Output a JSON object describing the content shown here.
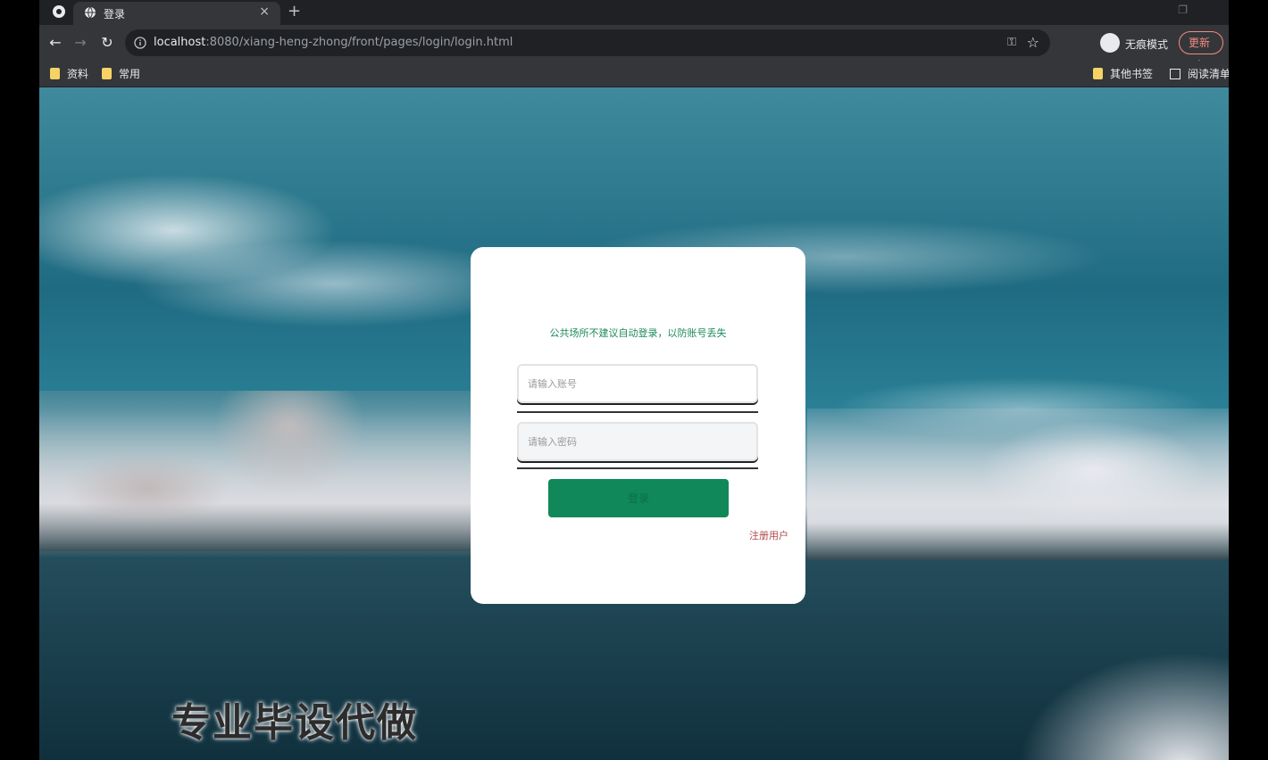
{
  "browser": {
    "tab_title": "登录",
    "tab_close": "×",
    "new_tab": "+",
    "url_host": "localhost",
    "url_path": ":8080/xiang-heng-zhong/front/pages/login/login.html",
    "incognito_label": "无痕模式",
    "update_label": "更新",
    "menu_glyph": "⋮"
  },
  "bookmarks": {
    "left": [
      "资料",
      "常用"
    ],
    "right": [
      "其他书签",
      "阅读清单"
    ]
  },
  "login": {
    "notice": "公共场所不建议自动登录，以防账号丢失",
    "username_placeholder": "请输入账号",
    "password_placeholder": "请输入密码",
    "submit_label": "登录",
    "register_label": "注册用户"
  },
  "watermark": "专业毕设代做",
  "colors": {
    "accent": "#10885a",
    "notice": "#1b8a5a",
    "link": "#b04a4a"
  }
}
